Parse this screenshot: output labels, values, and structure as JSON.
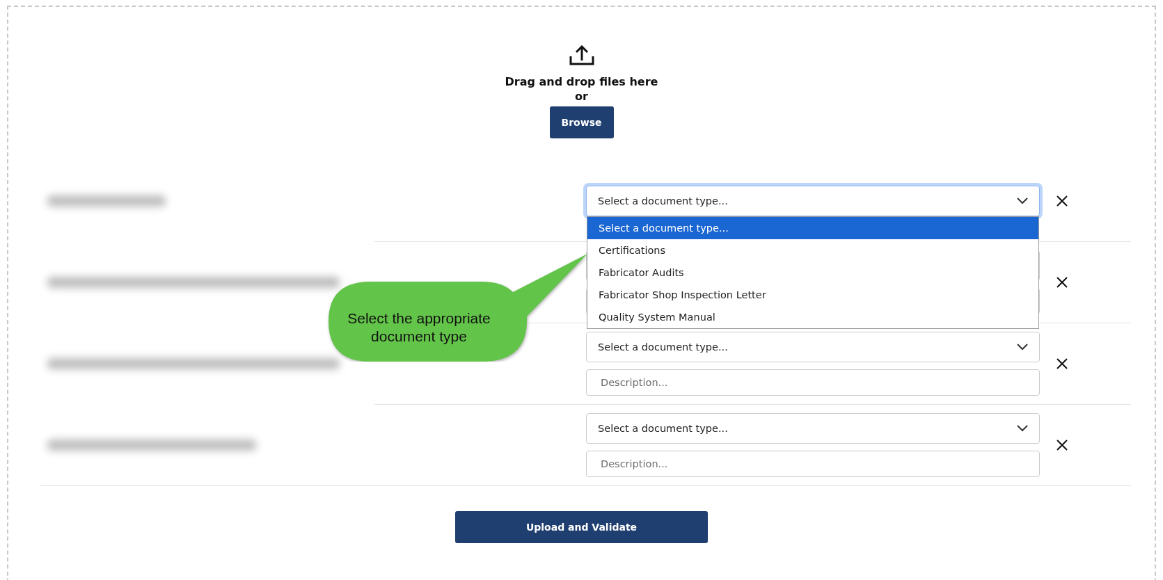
{
  "dropzone": {
    "title": "Drag and drop files here",
    "or_text": "or",
    "browse_button": "Browse"
  },
  "files": [
    {
      "select_value": "Select a document type...",
      "expanded": true,
      "options": [
        {
          "label": "Select a document type...",
          "selected": true
        },
        {
          "label": "Certifications",
          "selected": false
        },
        {
          "label": "Fabricator Audits",
          "selected": false
        },
        {
          "label": "Fabricator Shop Inspection Letter",
          "selected": false
        },
        {
          "label": "Quality System Manual",
          "selected": false
        }
      ]
    },
    {
      "expanded": false
    },
    {
      "select_value": "Select a document type...",
      "description_placeholder": "Description...",
      "expanded": false
    },
    {
      "select_value": "Select a document type...",
      "description_placeholder": "Description...",
      "expanded": false
    }
  ],
  "callout": {
    "text": "Select the appropriate document type"
  },
  "submit_button": "Upload and Validate"
}
